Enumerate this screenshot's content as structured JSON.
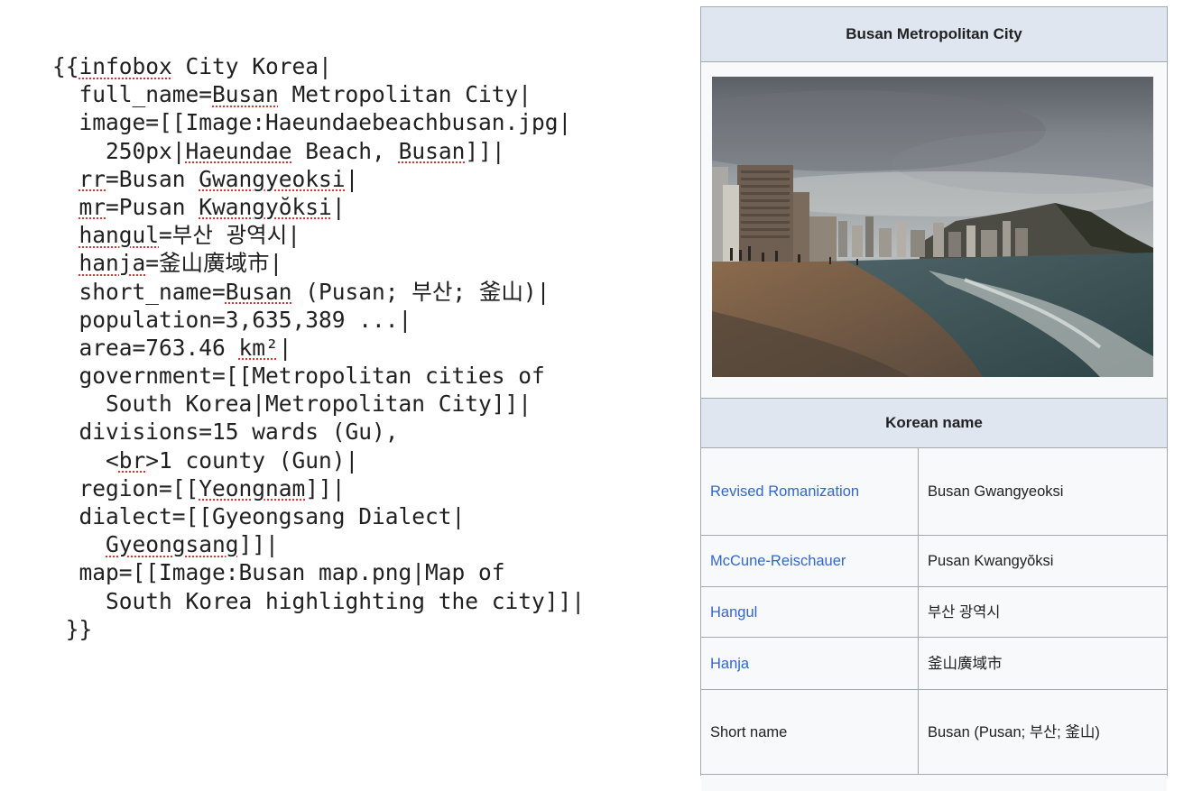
{
  "source": {
    "lines": [
      {
        "indent": "",
        "parts": [
          {
            "t": "{{"
          },
          {
            "t": "infobox",
            "s": true
          },
          {
            "t": " City Korea|"
          }
        ]
      },
      {
        "indent": "  ",
        "parts": [
          {
            "t": "full_name="
          },
          {
            "t": "Busan",
            "s": true
          },
          {
            "t": " Metropolitan City|"
          }
        ]
      },
      {
        "indent": "  ",
        "parts": [
          {
            "t": "image=[[Image:Haeundaebeachbusan.jpg|"
          }
        ]
      },
      {
        "indent": "    ",
        "parts": [
          {
            "t": "250px|"
          },
          {
            "t": "Haeundae",
            "s": true
          },
          {
            "t": " Beach, "
          },
          {
            "t": "Busan",
            "s": true
          },
          {
            "t": "]]|"
          }
        ]
      },
      {
        "indent": "  ",
        "parts": [
          {
            "t": "rr",
            "s": true
          },
          {
            "t": "=Busan "
          },
          {
            "t": "Gwangyeoksi",
            "s": true
          },
          {
            "t": "|"
          }
        ]
      },
      {
        "indent": "  ",
        "parts": [
          {
            "t": "mr",
            "s": true
          },
          {
            "t": "=Pusan "
          },
          {
            "t": "Kwangyŏksi",
            "s": true
          },
          {
            "t": "|"
          }
        ]
      },
      {
        "indent": "  ",
        "parts": [
          {
            "t": "hangul",
            "s": true
          },
          {
            "t": "=부산 광역시|"
          }
        ]
      },
      {
        "indent": "  ",
        "parts": [
          {
            "t": "hanja",
            "s": true
          },
          {
            "t": "=釜山廣域市|"
          }
        ]
      },
      {
        "indent": "  ",
        "parts": [
          {
            "t": "short_name="
          },
          {
            "t": "Busan",
            "s": true
          },
          {
            "t": " (Pusan; 부산; 釜山)|"
          }
        ]
      },
      {
        "indent": "  ",
        "parts": [
          {
            "t": "population=3,635,389 ...|"
          }
        ]
      },
      {
        "indent": "  ",
        "parts": [
          {
            "t": "area=763.46 "
          },
          {
            "t": "km²",
            "s": true
          },
          {
            "t": "|"
          }
        ]
      },
      {
        "indent": "  ",
        "parts": [
          {
            "t": "government=[[Metropolitan cities of"
          }
        ]
      },
      {
        "indent": "    ",
        "parts": [
          {
            "t": "South Korea|Metropolitan City]]|"
          }
        ]
      },
      {
        "indent": "  ",
        "parts": [
          {
            "t": "divisions=15 wards (Gu),"
          }
        ]
      },
      {
        "indent": "    ",
        "parts": [
          {
            "t": "<"
          },
          {
            "t": "br",
            "s": true
          },
          {
            "t": ">1 county (Gun)|"
          }
        ]
      },
      {
        "indent": "  ",
        "parts": [
          {
            "t": "region=[["
          },
          {
            "t": "Yeongnam",
            "s": true
          },
          {
            "t": "]]|"
          }
        ]
      },
      {
        "indent": "  ",
        "parts": [
          {
            "t": "dialect=[[Gyeongsang Dialect|"
          }
        ]
      },
      {
        "indent": "    ",
        "parts": [
          {
            "t": "Gyeongsang",
            "s": true
          },
          {
            "t": "]]|"
          }
        ]
      },
      {
        "indent": "  ",
        "parts": [
          {
            "t": "map=[[Image:Busan map.png|Map of"
          }
        ]
      },
      {
        "indent": "    ",
        "parts": [
          {
            "t": "South Korea highlighting the city]]|"
          }
        ]
      },
      {
        "indent": " ",
        "parts": [
          {
            "t": "}}"
          }
        ]
      }
    ]
  },
  "infobox": {
    "title": "Busan Metropolitan City",
    "subheader": "Korean name",
    "rows": [
      {
        "label": "Revised Romanization",
        "value": "Busan Gwangyeoksi",
        "link": true,
        "height": 96
      },
      {
        "label": "McCune-Reischauer",
        "value": "Pusan Kwangyŏksi",
        "link": true,
        "height": 56
      },
      {
        "label": "Hangul",
        "value": "부산 광역시",
        "link": true,
        "height": 55
      },
      {
        "label": "Hanja",
        "value": "釜山廣域市",
        "link": true,
        "height": 57
      },
      {
        "label": "Short name",
        "value": "Busan (Pusan; 부산; 釜山)",
        "link": false,
        "height": 93
      }
    ]
  },
  "colors": {
    "link": "#3366cc",
    "header_bg": "#dfe6f0",
    "border": "#a2a9b1",
    "box_bg": "#f8f9fa"
  }
}
